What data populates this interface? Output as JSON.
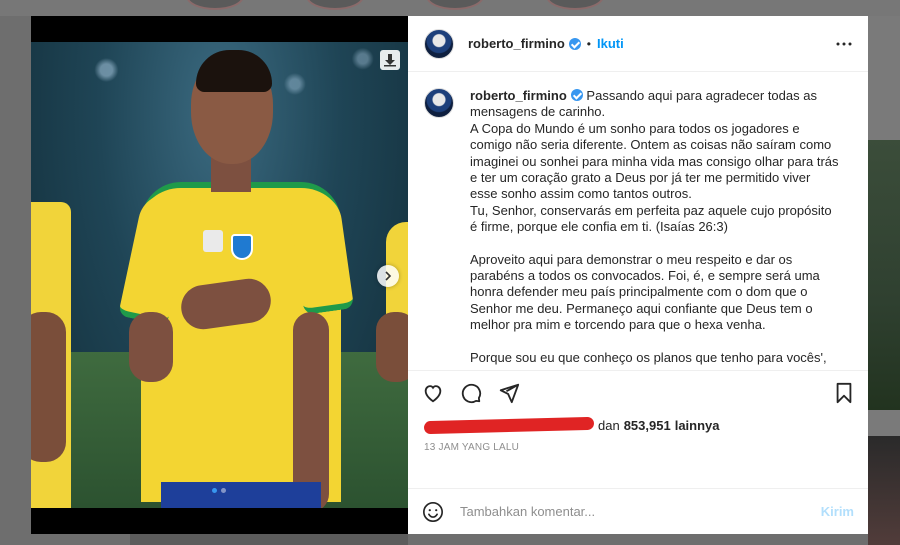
{
  "post": {
    "username": "roberto_firmino",
    "follow_label": "Ikuti",
    "more_label": "•••",
    "caption_paragraphs": [
      "Passando aqui para agradecer todas as mensagens de carinho.\nA Copa do Mundo é um sonho para todos os jogadores e comigo não seria diferente. Ontem as coisas não saíram como imaginei ou sonhei para minha vida mas consigo olhar para trás e ter um coração grato a Deus por já ter me permitido viver esse sonho assim como tantos outros.\nTu, Senhor, conservarás em perfeita paz aquele cujo propósito é firme, porque ele confia em ti. (Isaías 26:3)",
      "Aproveito aqui para demonstrar o meu respeito e dar os parabéns a todos os convocados. Foi, é, e sempre será uma honra defender meu país principalmente com o dom que o Senhor me deu. Permaneço aqui confiante que Deus tem o melhor pra mim e torcendo para que o hexa venha.",
      "Porque sou eu que conheço os planos que tenho para vocês', diz"
    ],
    "likes_text": "dan",
    "likes_count": "853,951",
    "likes_suffix": "lainnya",
    "timestamp": "13 JAM YANG LALU",
    "comment_placeholder": "Tambahkan komentar...",
    "post_button": "Kirim"
  },
  "media": {
    "carousel_count": 2,
    "active_index": 0
  },
  "icons": {
    "like": "heart-icon",
    "comment": "comment-icon",
    "share": "share-icon",
    "save": "bookmark-icon",
    "emoji": "emoji-icon",
    "download": "download-icon",
    "next": "chevron-right-icon"
  },
  "colors": {
    "accent": "#0095f6",
    "verified": "#3897f0",
    "post_disabled": "#b2dffc",
    "redaction": "#e02424"
  }
}
